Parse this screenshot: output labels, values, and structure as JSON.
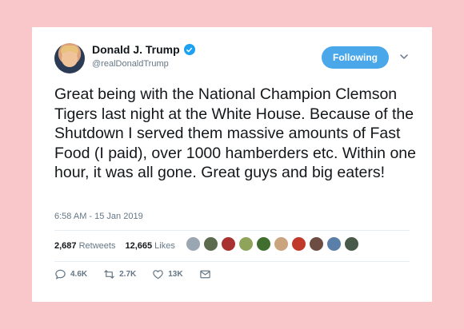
{
  "tweet": {
    "author_name": "Donald J. Trump",
    "author_handle": "@realDonaldTrump",
    "follow_label": "Following",
    "text": "Great being with the National Champion Clemson Tigers last night at the White House. Because of the Shutdown I served them massive amounts of Fast Food (I paid), over 1000 hamberders etc. Within one hour, it was all gone. Great guys and big eaters!",
    "timestamp": "6:58 AM - 15 Jan 2019",
    "retweets_count": "2,687",
    "retweets_label": "Retweets",
    "likes_count": "12,665",
    "likes_label": "Likes",
    "actions": {
      "replies": "4.6K",
      "retweets": "2.7K",
      "likes": "13K"
    }
  },
  "colors": {
    "background": "#f9c6c9",
    "follow_button": "#4aa8ea",
    "verified": "#1da1f2",
    "muted": "#657786"
  },
  "icons": [
    "verified-badge-icon",
    "chevron-down-icon",
    "reply-icon",
    "retweet-icon",
    "like-icon",
    "direct-message-icon"
  ]
}
